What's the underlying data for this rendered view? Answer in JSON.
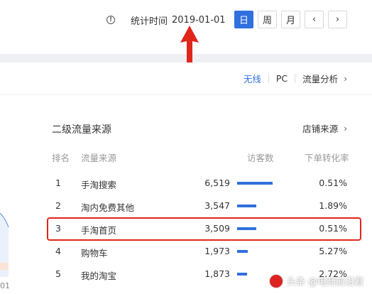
{
  "header": {
    "stat_label": "统计时间",
    "stat_date": "2019-01-01",
    "info_glyph": "!",
    "periods": [
      {
        "label": "日",
        "active": true
      },
      {
        "label": "周",
        "active": false
      },
      {
        "label": "月",
        "active": false
      }
    ],
    "prev_glyph": "‹",
    "next_glyph": "›"
  },
  "device_tabs": {
    "wifi": "无线",
    "pc": "PC",
    "analysis": "流量分析",
    "chevron": "›"
  },
  "section": {
    "title": "二级流量来源",
    "shop_source": "店铺来源",
    "chevron": "›"
  },
  "table": {
    "columns": [
      "排名",
      "流量来源",
      "访客数",
      "下单转化率"
    ],
    "rows": [
      {
        "rank": "1",
        "source": "手淘搜索",
        "visitors": "6,519",
        "bar": 6519,
        "rate": "0.51%"
      },
      {
        "rank": "2",
        "source": "淘内免费其他",
        "visitors": "3,547",
        "bar": 3547,
        "rate": "1.89%"
      },
      {
        "rank": "3",
        "source": "手淘首页",
        "visitors": "3,509",
        "bar": 3509,
        "rate": "0.51%"
      },
      {
        "rank": "4",
        "source": "购物车",
        "visitors": "1,973",
        "bar": 1973,
        "rate": "5.27%"
      },
      {
        "rank": "5",
        "source": "我的淘宝",
        "visitors": "1,873",
        "bar": 1873,
        "rate": "2.72%"
      }
    ],
    "highlighted_rank": "3"
  },
  "chart_axis_label": "01",
  "watermark": "头条 @电商前沿君",
  "colors": {
    "accent": "#2f6fde",
    "highlight": "#e0251b"
  }
}
